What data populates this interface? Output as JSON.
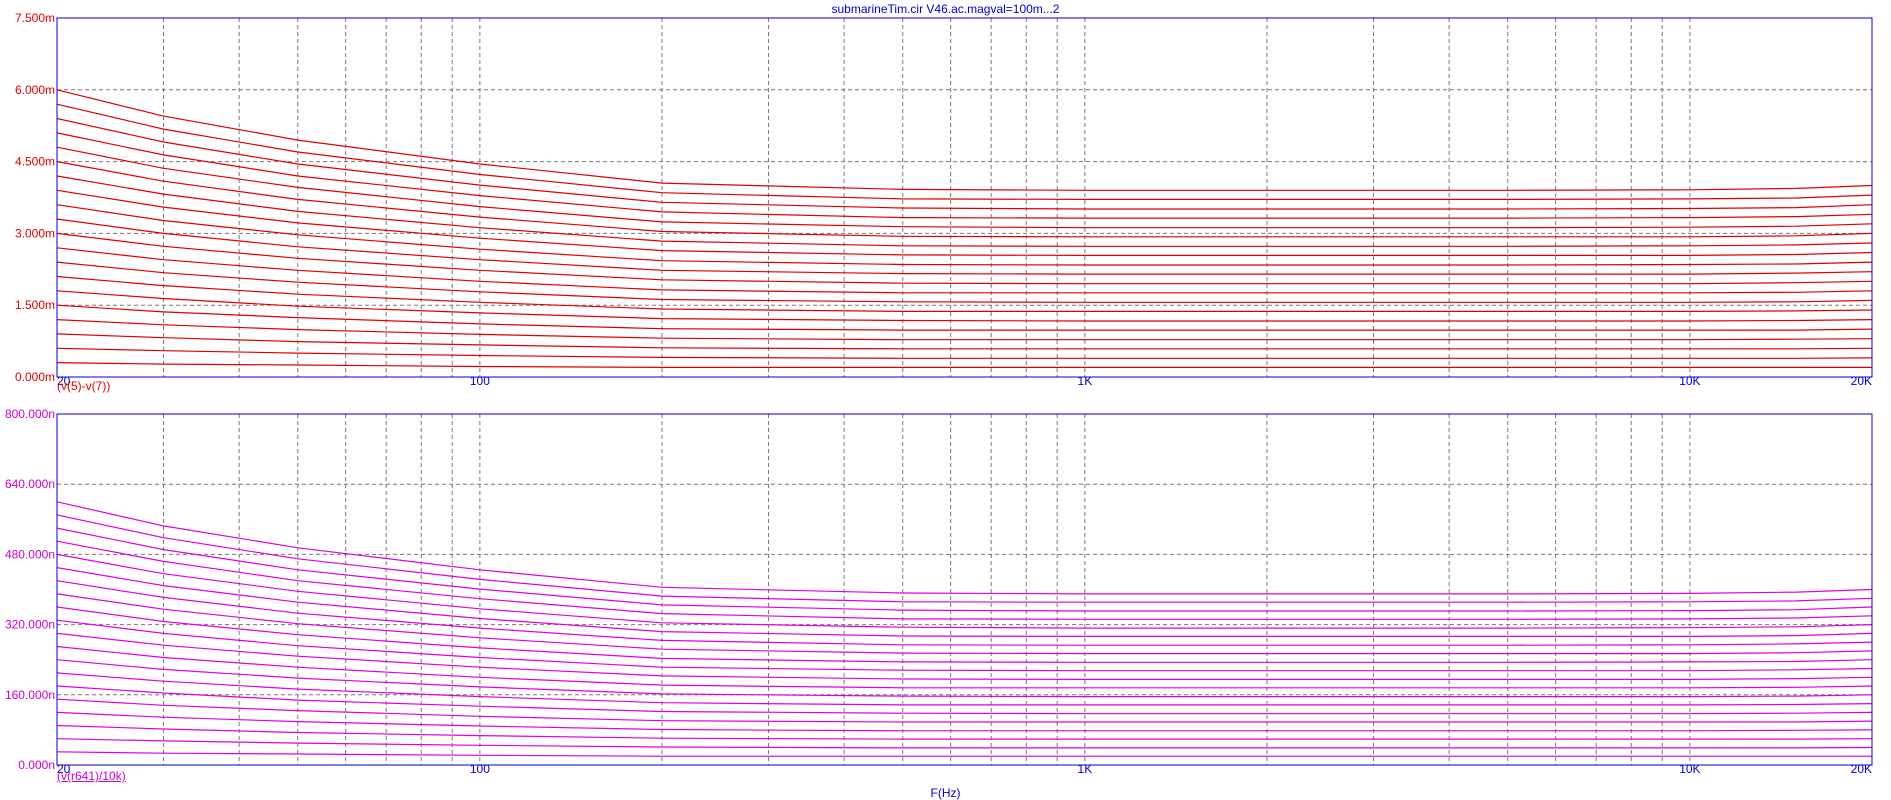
{
  "title": "submarineTim.cir V46.ac.magval=100m...2",
  "x_axis_label": "F(Hz)",
  "colors": {
    "axis": "#0000cc",
    "grid": "#777777",
    "top_trace": "#e00000",
    "bottom_trace": "#e000e0",
    "bottom_label": "#cc00cc"
  },
  "chart_data": [
    {
      "type": "line",
      "x_scale": "log",
      "xlim": [
        20,
        20000
      ],
      "x_ticks": [
        {
          "value": 20,
          "label": "20"
        },
        {
          "value": 100,
          "label": "100"
        },
        {
          "value": 1000,
          "label": "1K"
        },
        {
          "value": 10000,
          "label": "10K"
        },
        {
          "value": 20000,
          "label": "20K"
        }
      ],
      "ylim": [
        0,
        0.0075
      ],
      "y_ticks": [
        {
          "value": 0,
          "label": "0.000m"
        },
        {
          "value": 0.0015,
          "label": "1.500m"
        },
        {
          "value": 0.003,
          "label": "3.000m"
        },
        {
          "value": 0.0045,
          "label": "4.500m"
        },
        {
          "value": 0.006,
          "label": "6.000m"
        },
        {
          "value": 0.0075,
          "label": "7.500m"
        }
      ],
      "trace_label": "(v(5)-v(7))",
      "series_count": 20,
      "x": [
        20,
        30,
        50,
        100,
        200,
        500,
        1000,
        5000,
        10000,
        15000,
        20000
      ],
      "series": [
        {
          "values": [
            0.006,
            0.00545,
            0.00495,
            0.00445,
            0.00405,
            0.00392,
            0.0039,
            0.0039,
            0.00391,
            0.00394,
            0.004
          ]
        },
        {
          "values": [
            0.0057,
            0.00518,
            0.0047,
            0.00423,
            0.00385,
            0.00372,
            0.00371,
            0.00371,
            0.00372,
            0.00374,
            0.0038
          ]
        },
        {
          "values": [
            0.0054,
            0.00491,
            0.00445,
            0.00401,
            0.00365,
            0.00353,
            0.00351,
            0.00351,
            0.00352,
            0.00354,
            0.0036
          ]
        },
        {
          "values": [
            0.0051,
            0.00464,
            0.0042,
            0.00379,
            0.00345,
            0.00333,
            0.00332,
            0.00332,
            0.00333,
            0.00335,
            0.0034
          ]
        },
        {
          "values": [
            0.0048,
            0.00436,
            0.00396,
            0.00356,
            0.00324,
            0.00314,
            0.00312,
            0.00312,
            0.00313,
            0.00315,
            0.0032
          ]
        },
        {
          "values": [
            0.0045,
            0.00409,
            0.00371,
            0.00334,
            0.00304,
            0.00294,
            0.00293,
            0.00293,
            0.00293,
            0.00295,
            0.003
          ]
        },
        {
          "values": [
            0.0042,
            0.00382,
            0.00346,
            0.00312,
            0.00284,
            0.00274,
            0.00273,
            0.00273,
            0.00274,
            0.00276,
            0.0028
          ]
        },
        {
          "values": [
            0.0039,
            0.00355,
            0.00322,
            0.0029,
            0.00264,
            0.00255,
            0.00254,
            0.00254,
            0.00254,
            0.00256,
            0.0026
          ]
        },
        {
          "values": [
            0.0036,
            0.00327,
            0.00297,
            0.00267,
            0.00243,
            0.00235,
            0.00234,
            0.00234,
            0.00235,
            0.00236,
            0.0024
          ]
        },
        {
          "values": [
            0.0033,
            0.003,
            0.00272,
            0.00245,
            0.00223,
            0.00216,
            0.00215,
            0.00215,
            0.00215,
            0.00217,
            0.0022
          ]
        },
        {
          "values": [
            0.003,
            0.00273,
            0.00248,
            0.00223,
            0.00203,
            0.00196,
            0.00195,
            0.00195,
            0.00195,
            0.00197,
            0.002
          ]
        },
        {
          "values": [
            0.0027,
            0.00245,
            0.00223,
            0.002,
            0.00182,
            0.00176,
            0.00176,
            0.00176,
            0.00176,
            0.00177,
            0.0018
          ]
        },
        {
          "values": [
            0.0024,
            0.00218,
            0.00198,
            0.00178,
            0.00162,
            0.00157,
            0.00156,
            0.00156,
            0.00156,
            0.00157,
            0.0016
          ]
        },
        {
          "values": [
            0.0021,
            0.00191,
            0.00173,
            0.00156,
            0.00142,
            0.00137,
            0.00137,
            0.00137,
            0.00137,
            0.00138,
            0.0014
          ]
        },
        {
          "values": [
            0.0018,
            0.00164,
            0.00148,
            0.00134,
            0.00122,
            0.00118,
            0.00117,
            0.00117,
            0.00117,
            0.00118,
            0.0012
          ]
        },
        {
          "values": [
            0.0015,
            0.00136,
            0.00124,
            0.00111,
            0.00101,
            0.00098,
            0.00098,
            0.00098,
            0.00098,
            0.00098,
            0.001
          ]
        },
        {
          "values": [
            0.0012,
            0.00109,
            0.00099,
            0.00089,
            0.00081,
            0.00078,
            0.00078,
            0.00078,
            0.00078,
            0.00079,
            0.0008
          ]
        },
        {
          "values": [
            0.0009,
            0.00082,
            0.00074,
            0.00067,
            0.00061,
            0.00059,
            0.00059,
            0.00059,
            0.00059,
            0.00059,
            0.0006
          ]
        },
        {
          "values": [
            0.0006,
            0.00055,
            0.0005,
            0.00045,
            0.00041,
            0.00039,
            0.00039,
            0.00039,
            0.00039,
            0.00039,
            0.0004
          ]
        },
        {
          "values": [
            0.0003,
            0.00027,
            0.00025,
            0.00022,
            0.0002,
            0.0002,
            0.0002,
            0.0002,
            0.0002,
            0.0002,
            0.0002
          ]
        }
      ]
    },
    {
      "type": "line",
      "x_scale": "log",
      "xlim": [
        20,
        20000
      ],
      "x_ticks": [
        {
          "value": 20,
          "label": "20"
        },
        {
          "value": 100,
          "label": "100"
        },
        {
          "value": 1000,
          "label": "1K"
        },
        {
          "value": 10000,
          "label": "10K"
        },
        {
          "value": 20000,
          "label": "20K"
        }
      ],
      "ylim": [
        0,
        0.0008
      ],
      "y_ticks": [
        {
          "value": 0,
          "label": "0.000n"
        },
        {
          "value": 0.00016,
          "label": "160.000n"
        },
        {
          "value": 0.00032,
          "label": "320.000n"
        },
        {
          "value": 0.00048,
          "label": "480.000n"
        },
        {
          "value": 0.00064,
          "label": "640.000n"
        },
        {
          "value": 0.0008,
          "label": "800.000n"
        }
      ],
      "trace_label": "(v(r641)/10k)",
      "series_count": 20,
      "x": [
        20,
        30,
        50,
        100,
        200,
        500,
        1000,
        5000,
        10000,
        15000,
        20000
      ],
      "series": [
        {
          "values": [
            0.0006,
            0.000545,
            0.000495,
            0.000445,
            0.000405,
            0.000392,
            0.00039,
            0.00039,
            0.000391,
            0.000394,
            0.0004
          ]
        },
        {
          "values": [
            0.00057,
            0.000518,
            0.00047,
            0.000423,
            0.000385,
            0.000372,
            0.000371,
            0.000371,
            0.000372,
            0.000374,
            0.00038
          ]
        },
        {
          "values": [
            0.00054,
            0.000491,
            0.000445,
            0.000401,
            0.000365,
            0.000353,
            0.000351,
            0.000351,
            0.000352,
            0.000354,
            0.00036
          ]
        },
        {
          "values": [
            0.00051,
            0.000464,
            0.00042,
            0.000379,
            0.000345,
            0.000333,
            0.000332,
            0.000332,
            0.000333,
            0.000335,
            0.00034
          ]
        },
        {
          "values": [
            0.00048,
            0.000436,
            0.000396,
            0.000356,
            0.000324,
            0.000314,
            0.000312,
            0.000312,
            0.000313,
            0.000315,
            0.00032
          ]
        },
        {
          "values": [
            0.00045,
            0.000409,
            0.000371,
            0.000334,
            0.000304,
            0.000294,
            0.000293,
            0.000293,
            0.000293,
            0.000295,
            0.0003
          ]
        },
        {
          "values": [
            0.00042,
            0.000382,
            0.000346,
            0.000312,
            0.000284,
            0.000274,
            0.000273,
            0.000273,
            0.000274,
            0.000276,
            0.00028
          ]
        },
        {
          "values": [
            0.00039,
            0.000355,
            0.000322,
            0.00029,
            0.000264,
            0.000255,
            0.000254,
            0.000254,
            0.000254,
            0.000256,
            0.00026
          ]
        },
        {
          "values": [
            0.00036,
            0.000327,
            0.000297,
            0.000267,
            0.000243,
            0.000235,
            0.000234,
            0.000234,
            0.000235,
            0.000236,
            0.00024
          ]
        },
        {
          "values": [
            0.00033,
            0.0003,
            0.000272,
            0.000245,
            0.000223,
            0.000216,
            0.000215,
            0.000215,
            0.000215,
            0.000217,
            0.00022
          ]
        },
        {
          "values": [
            0.0003,
            0.000273,
            0.000248,
            0.000223,
            0.000203,
            0.000196,
            0.000195,
            0.000195,
            0.000195,
            0.000197,
            0.0002
          ]
        },
        {
          "values": [
            0.00027,
            0.000245,
            0.000223,
            0.0002,
            0.000182,
            0.000176,
            0.000176,
            0.000176,
            0.000176,
            0.000177,
            0.00018
          ]
        },
        {
          "values": [
            0.00024,
            0.000218,
            0.000198,
            0.000178,
            0.000162,
            0.000157,
            0.000156,
            0.000156,
            0.000156,
            0.000157,
            0.00016
          ]
        },
        {
          "values": [
            0.00021,
            0.000191,
            0.000173,
            0.000156,
            0.000142,
            0.000137,
            0.000137,
            0.000137,
            0.000137,
            0.000138,
            0.00014
          ]
        },
        {
          "values": [
            0.00018,
            0.000164,
            0.000148,
            0.000134,
            0.000122,
            0.000118,
            0.000117,
            0.000117,
            0.000117,
            0.000118,
            0.00012
          ]
        },
        {
          "values": [
            0.00015,
            0.000136,
            0.000124,
            0.000111,
            0.000101,
            9.8e-05,
            9.8e-05,
            9.8e-05,
            9.8e-05,
            9.8e-05,
            0.0001
          ]
        },
        {
          "values": [
            0.00012,
            0.000109,
            9.9e-05,
            8.9e-05,
            8.1e-05,
            7.8e-05,
            7.8e-05,
            7.8e-05,
            7.8e-05,
            7.9e-05,
            8e-05
          ]
        },
        {
          "values": [
            9e-05,
            8.2e-05,
            7.4e-05,
            6.7e-05,
            6.1e-05,
            5.9e-05,
            5.9e-05,
            5.9e-05,
            5.9e-05,
            5.9e-05,
            6e-05
          ]
        },
        {
          "values": [
            6e-05,
            5.5e-05,
            5e-05,
            4.5e-05,
            4.1e-05,
            3.9e-05,
            3.9e-05,
            3.9e-05,
            3.9e-05,
            3.9e-05,
            4e-05
          ]
        },
        {
          "values": [
            3e-05,
            2.7e-05,
            2.5e-05,
            2.2e-05,
            2e-05,
            2e-05,
            2e-05,
            2e-05,
            2e-05,
            2e-05,
            2e-05
          ]
        }
      ]
    }
  ]
}
